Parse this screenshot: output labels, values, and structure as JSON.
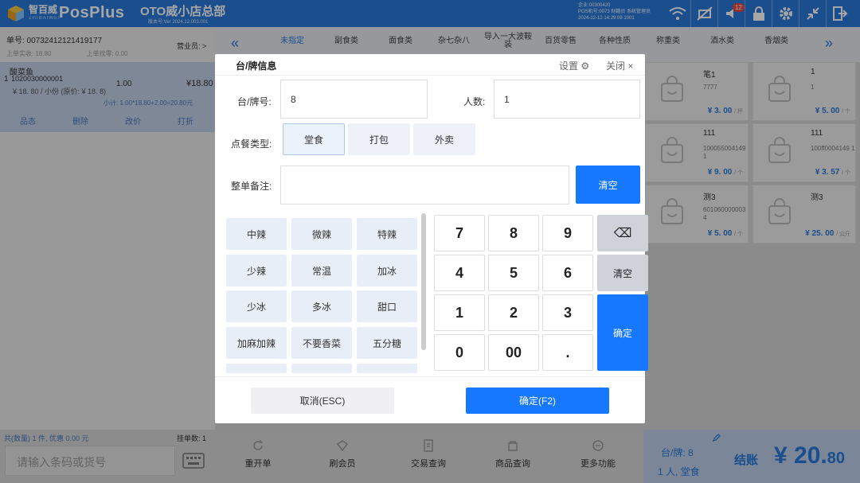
{
  "header": {
    "brand_cn": "智百威",
    "brand_en": "ZHIBAIWEI",
    "app_name": "PosPlus",
    "store_name": "OTO威小店总部",
    "version": "版本号:Ver 2024.12.003.001",
    "user_line1": "企业:00300420",
    "user_line2": "POS机号:0073  财籍员  系统管理员",
    "user_line3": "2024-12-12 14:29:09  1001",
    "notify_count": "12",
    "accent_color": "#2979d9"
  },
  "order": {
    "order_no": "单号: 00732412121419177",
    "salesperson": "营业员: >",
    "last_received": "上单实收: 18.80",
    "last_change": "上单找零: 0.00",
    "item": {
      "name": "酸菜鱼",
      "index": "1",
      "code": "1020030000001",
      "qty": "1.00",
      "amount": "¥18.80",
      "unit_price": "¥ 18. 80 / 小份  (原价: ¥ 18. 8)",
      "subtotal": "小计: 1.00*18.80+2.00=20.80元"
    },
    "actions": [
      "品态",
      "删除",
      "改价",
      "打折"
    ]
  },
  "categories": [
    "未指定",
    "副食类",
    "面食类",
    "杂七杂八",
    "导入一大波鞍装",
    "百货零售",
    "各种性质",
    "称重类",
    "酒水类",
    "香烟类"
  ],
  "products": [
    {
      "name": "笔1",
      "code": "7777",
      "price": "¥ 3. 00",
      "unit": "/ 杯"
    },
    {
      "name": "1",
      "code": "1",
      "price": "¥ 5. 00",
      "unit": "/ 个"
    },
    {
      "name": "111",
      "code": "1000550041491",
      "price": "¥ 9. 00",
      "unit": "/ 个"
    },
    {
      "name": "111",
      "code": "100ff0004149 1",
      "price": "¥ 3. 57",
      "unit": "/ 个"
    },
    {
      "name": "测3",
      "code": "6010600000034",
      "price": "¥ 5. 00",
      "unit": "/ 个"
    },
    {
      "name": "测3",
      "code": "",
      "price": "¥ 25. 00",
      "unit": "/ 公斤"
    }
  ],
  "modal": {
    "title": "台/牌信息",
    "settings": "设置 ⚙",
    "close": "关闭 ×",
    "table_label": "台/牌号:",
    "table_value": "8",
    "people_label": "人数:",
    "people_value": "1",
    "order_type_label": "点餐类型:",
    "order_types": [
      "堂食",
      "打包",
      "外卖"
    ],
    "selected_type": "堂食",
    "remark_label": "整单备注:",
    "remark_value": "",
    "clear_label": "清空",
    "remarks": [
      "中辣",
      "微辣",
      "特辣",
      "少辣",
      "常温",
      "加冰",
      "少冰",
      "多冰",
      "甜口",
      "加麻加辣",
      "不要香菜",
      "五分糖"
    ],
    "keys": [
      "7",
      "8",
      "9",
      "4",
      "5",
      "6",
      "1",
      "2",
      "3",
      "0",
      "00",
      "."
    ],
    "backspace": "⌫",
    "key_clear": "清空",
    "key_confirm": "确定",
    "cancel": "取消(ESC)",
    "confirm": "确定(F2)"
  },
  "bottom": {
    "summary": "共(数量) 1 件, 优惠 0.00 元",
    "hang_count": "挂单数: 1",
    "barcode_placeholder": "请输入条码或货号",
    "functions": [
      "重开单",
      "刷会员",
      "交易查询",
      "商品查询",
      "更多功能"
    ],
    "table_info_1": "台/牌:  8",
    "table_info_2": "1 人,  堂食",
    "checkout_label": "结账",
    "total_main": "¥ 20.",
    "total_cents": "80"
  }
}
